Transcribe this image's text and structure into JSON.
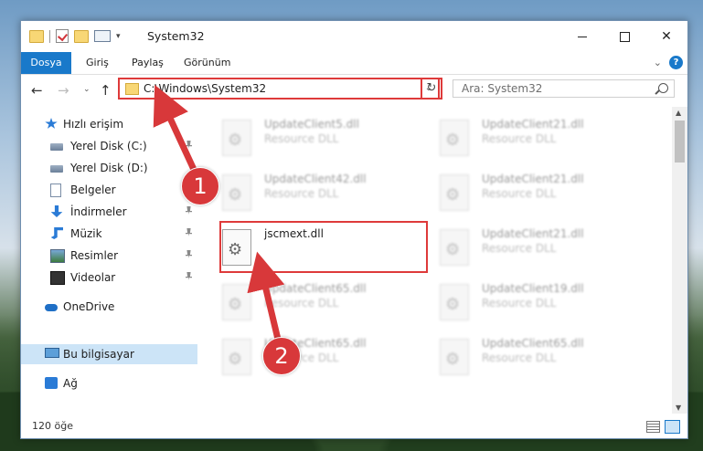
{
  "window": {
    "title": "System32",
    "minimize_symbol": "",
    "close_symbol": "✕"
  },
  "ribbon": {
    "tabs": [
      "Dosya",
      "Giriş",
      "Paylaş",
      "Görünüm"
    ],
    "expand_symbol": "⌄",
    "help_symbol": "?"
  },
  "address": {
    "path": "C:\\Windows\\System32",
    "dropdown_symbol": "⌄",
    "refresh_symbol": "↻",
    "back_symbol": "←",
    "forward_symbol": "→",
    "recent_symbol": "⌄",
    "up_symbol": "↑"
  },
  "search": {
    "placeholder": "Ara: System32"
  },
  "navpane": {
    "quick_access": "Hızlı erişim",
    "items": [
      {
        "label": "Yerel Disk (C:)",
        "pinned": true
      },
      {
        "label": "Yerel Disk (D:)",
        "pinned": false
      },
      {
        "label": "Belgeler",
        "pinned": true
      },
      {
        "label": "İndirmeler",
        "pinned": true
      },
      {
        "label": "Müzik",
        "pinned": true
      },
      {
        "label": "Resimler",
        "pinned": true
      },
      {
        "label": "Videolar",
        "pinned": true
      }
    ],
    "onedrive": "OneDrive",
    "this_pc": "Bu bilgisayar",
    "network": "Ağ"
  },
  "files": [
    {
      "name": "UpdateClient5.dll",
      "type": "Resource DLL"
    },
    {
      "name": "UpdateClient21.dll",
      "type": "Resource DLL"
    },
    {
      "name": "UpdateClient42.dll",
      "type": "Resource DLL"
    },
    {
      "name": "UpdateClient21.dll",
      "type": "Resource DLL"
    },
    {
      "name": "jscmext.dll",
      "type": ""
    },
    {
      "name": "UpdateClient21.dll",
      "type": "Resource DLL"
    },
    {
      "name": "UpdateClient65.dll",
      "type": "Resource DLL"
    },
    {
      "name": "UpdateClient19.dll",
      "type": "Resource DLL"
    },
    {
      "name": "UpdateClient65.dll",
      "type": "Resource DLL"
    },
    {
      "name": "UpdateClient65.dll",
      "type": "Resource DLL"
    }
  ],
  "status": {
    "item_count": "120 öğe"
  },
  "annotations": {
    "step1": "1",
    "step2": "2",
    "color": "#d8383a"
  }
}
